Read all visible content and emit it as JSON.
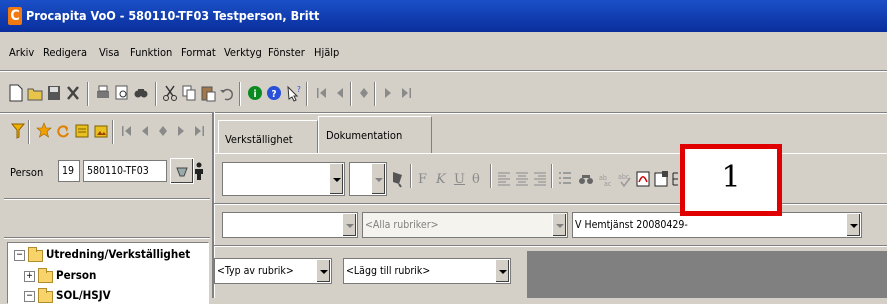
{
  "app": {
    "icon_letter": "C",
    "title": "Procapita VoO - 580110-TF03 Testperson, Britt"
  },
  "menu": [
    "Arkiv",
    "Redigera",
    "Visa",
    "Funktion",
    "Format",
    "Verktyg",
    "Fönster",
    "Hjälp"
  ],
  "person": {
    "label": "Person",
    "number": "19",
    "id": "580110-TF03"
  },
  "tabs": [
    {
      "label": "Verkställighet",
      "active": false
    },
    {
      "label": "Dokumentation",
      "active": true
    }
  ],
  "format_toolbar": {
    "bold": "F",
    "italic": "K",
    "underline": "U",
    "strike": "θ"
  },
  "filters": {
    "rubriker_placeholder": "<Alla rubriker>",
    "document": "V Hemtjänst 20080429-",
    "typ_av_rubrik": "<Typ av rubrik>",
    "lagg_till_rubrik": "<Lägg till rubrik>"
  },
  "tree": [
    {
      "label": "Utredning/Verkställighet",
      "expander": "⊟"
    },
    {
      "label": "Person",
      "expander": "⊞"
    },
    {
      "label": "SOL/HSJV",
      "expander": "⊟"
    }
  ],
  "callout": {
    "number": "1"
  },
  "colors": {
    "titlebar": "#0a2e9c",
    "callout_border": "#e00000",
    "app_icon": "#f07a10"
  }
}
